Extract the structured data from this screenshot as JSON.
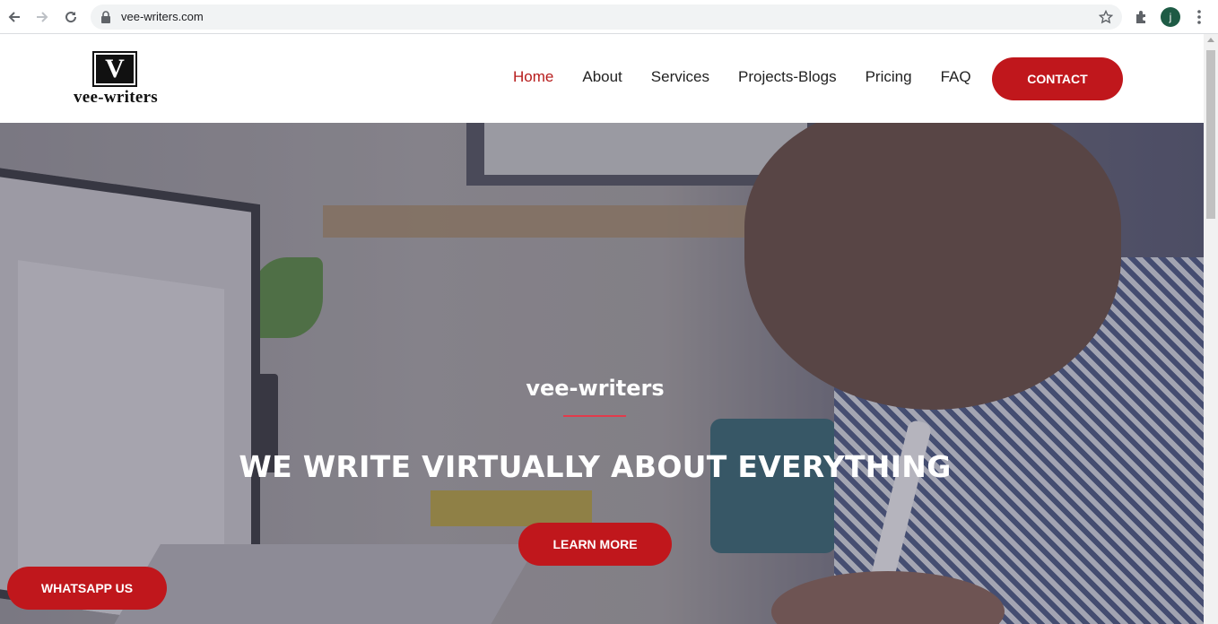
{
  "browser": {
    "url": "vee-writers.com",
    "profile_initial": "j"
  },
  "site": {
    "logo_mark": "V",
    "logo_text": "vee-writers"
  },
  "nav": {
    "items": [
      {
        "label": "Home",
        "active": true
      },
      {
        "label": "About",
        "active": false
      },
      {
        "label": "Services",
        "active": false
      },
      {
        "label": "Projects-Blogs",
        "active": false
      },
      {
        "label": "Pricing",
        "active": false
      },
      {
        "label": "FAQ",
        "active": false
      }
    ],
    "contact_label": "CONTACT"
  },
  "hero": {
    "subtitle": "vee-writers",
    "title": "WE WRITE VIRTUALLY ABOUT EVERYTHING",
    "cta_label": "LEARN MORE"
  },
  "whatsapp": {
    "label": "WHATSAPP US"
  },
  "colors": {
    "accent": "#c0171c",
    "nav_active": "#b71c1c",
    "underline": "#e23b4b"
  }
}
